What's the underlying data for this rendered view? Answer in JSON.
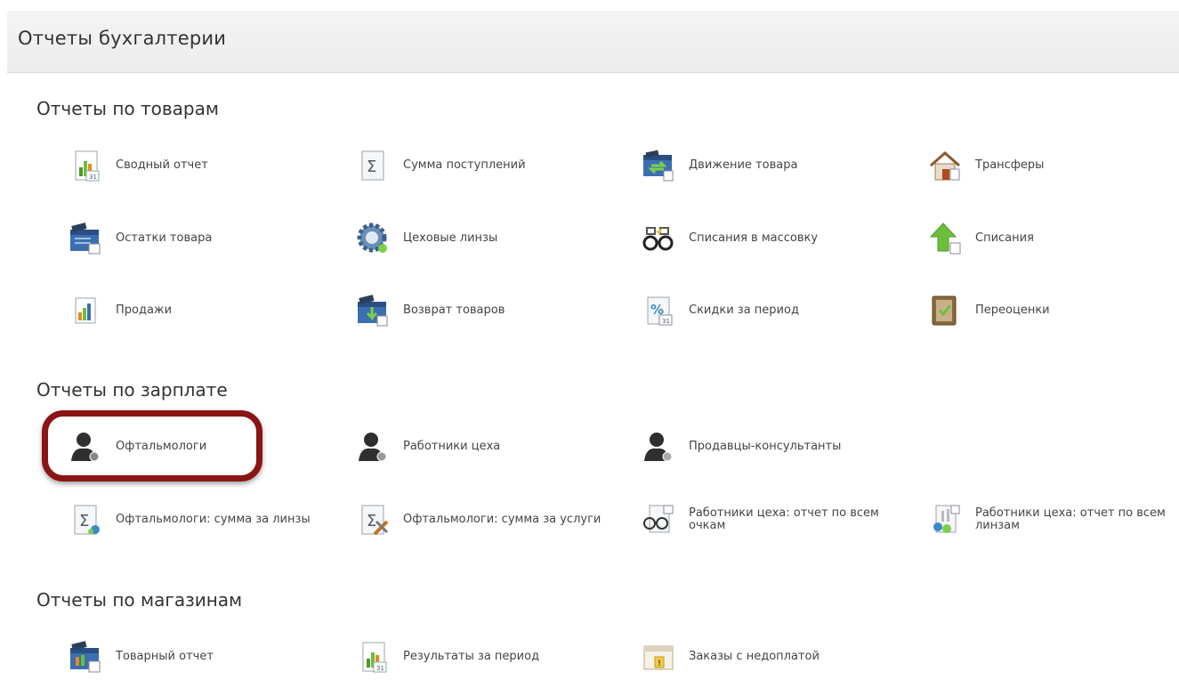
{
  "page": {
    "title": "Отчеты бухгалтерии"
  },
  "sections": {
    "goods": {
      "title": "Отчеты по товарам",
      "items": [
        {
          "label": "Сводный отчет",
          "icon": "summary-report-icon"
        },
        {
          "label": "Сумма поступлений",
          "icon": "sigma-icon"
        },
        {
          "label": "Движение товара",
          "icon": "goods-movement-icon"
        },
        {
          "label": "Трансферы",
          "icon": "transfer-house-icon"
        },
        {
          "label": "Остатки товара",
          "icon": "goods-stock-icon"
        },
        {
          "label": "Цеховые линзы",
          "icon": "gear-icon"
        },
        {
          "label": "Списания в массовку",
          "icon": "glasses-icon"
        },
        {
          "label": "Списания",
          "icon": "arrow-up-icon"
        },
        {
          "label": "Продажи",
          "icon": "sales-chart-icon"
        },
        {
          "label": "Возврат товаров",
          "icon": "goods-return-icon"
        },
        {
          "label": "Скидки за период",
          "icon": "discount-icon"
        },
        {
          "label": "Переоценки",
          "icon": "revaluation-icon"
        }
      ]
    },
    "salary": {
      "title": "Отчеты по зарплате",
      "items": [
        {
          "label": "Офтальмологи",
          "icon": "person-icon"
        },
        {
          "label": "Работники цеха",
          "icon": "person-icon"
        },
        {
          "label": "Продавцы-консультанты",
          "icon": "person-icon"
        },
        {
          "label": "Офтальмологи: сумма за линзы",
          "icon": "sigma-lens-icon"
        },
        {
          "label": "Офтальмологи: сумма за услуги",
          "icon": "sigma-tools-icon"
        },
        {
          "label": "Работники цеха: отчет по всем очкам",
          "icon": "glasses-doc-icon"
        },
        {
          "label": "Работники цеха: отчет по всем линзам",
          "icon": "lenses-doc-icon"
        }
      ]
    },
    "stores": {
      "title": "Отчеты по магазинам",
      "items": [
        {
          "label": "Товарный отчет",
          "icon": "store-report-icon"
        },
        {
          "label": "Результаты за период",
          "icon": "period-results-icon"
        },
        {
          "label": "Заказы с недоплатой",
          "icon": "underpaid-orders-icon"
        }
      ]
    }
  },
  "colors": {
    "highlight": "#8b1414",
    "header_bg": "#f0f0f0"
  }
}
